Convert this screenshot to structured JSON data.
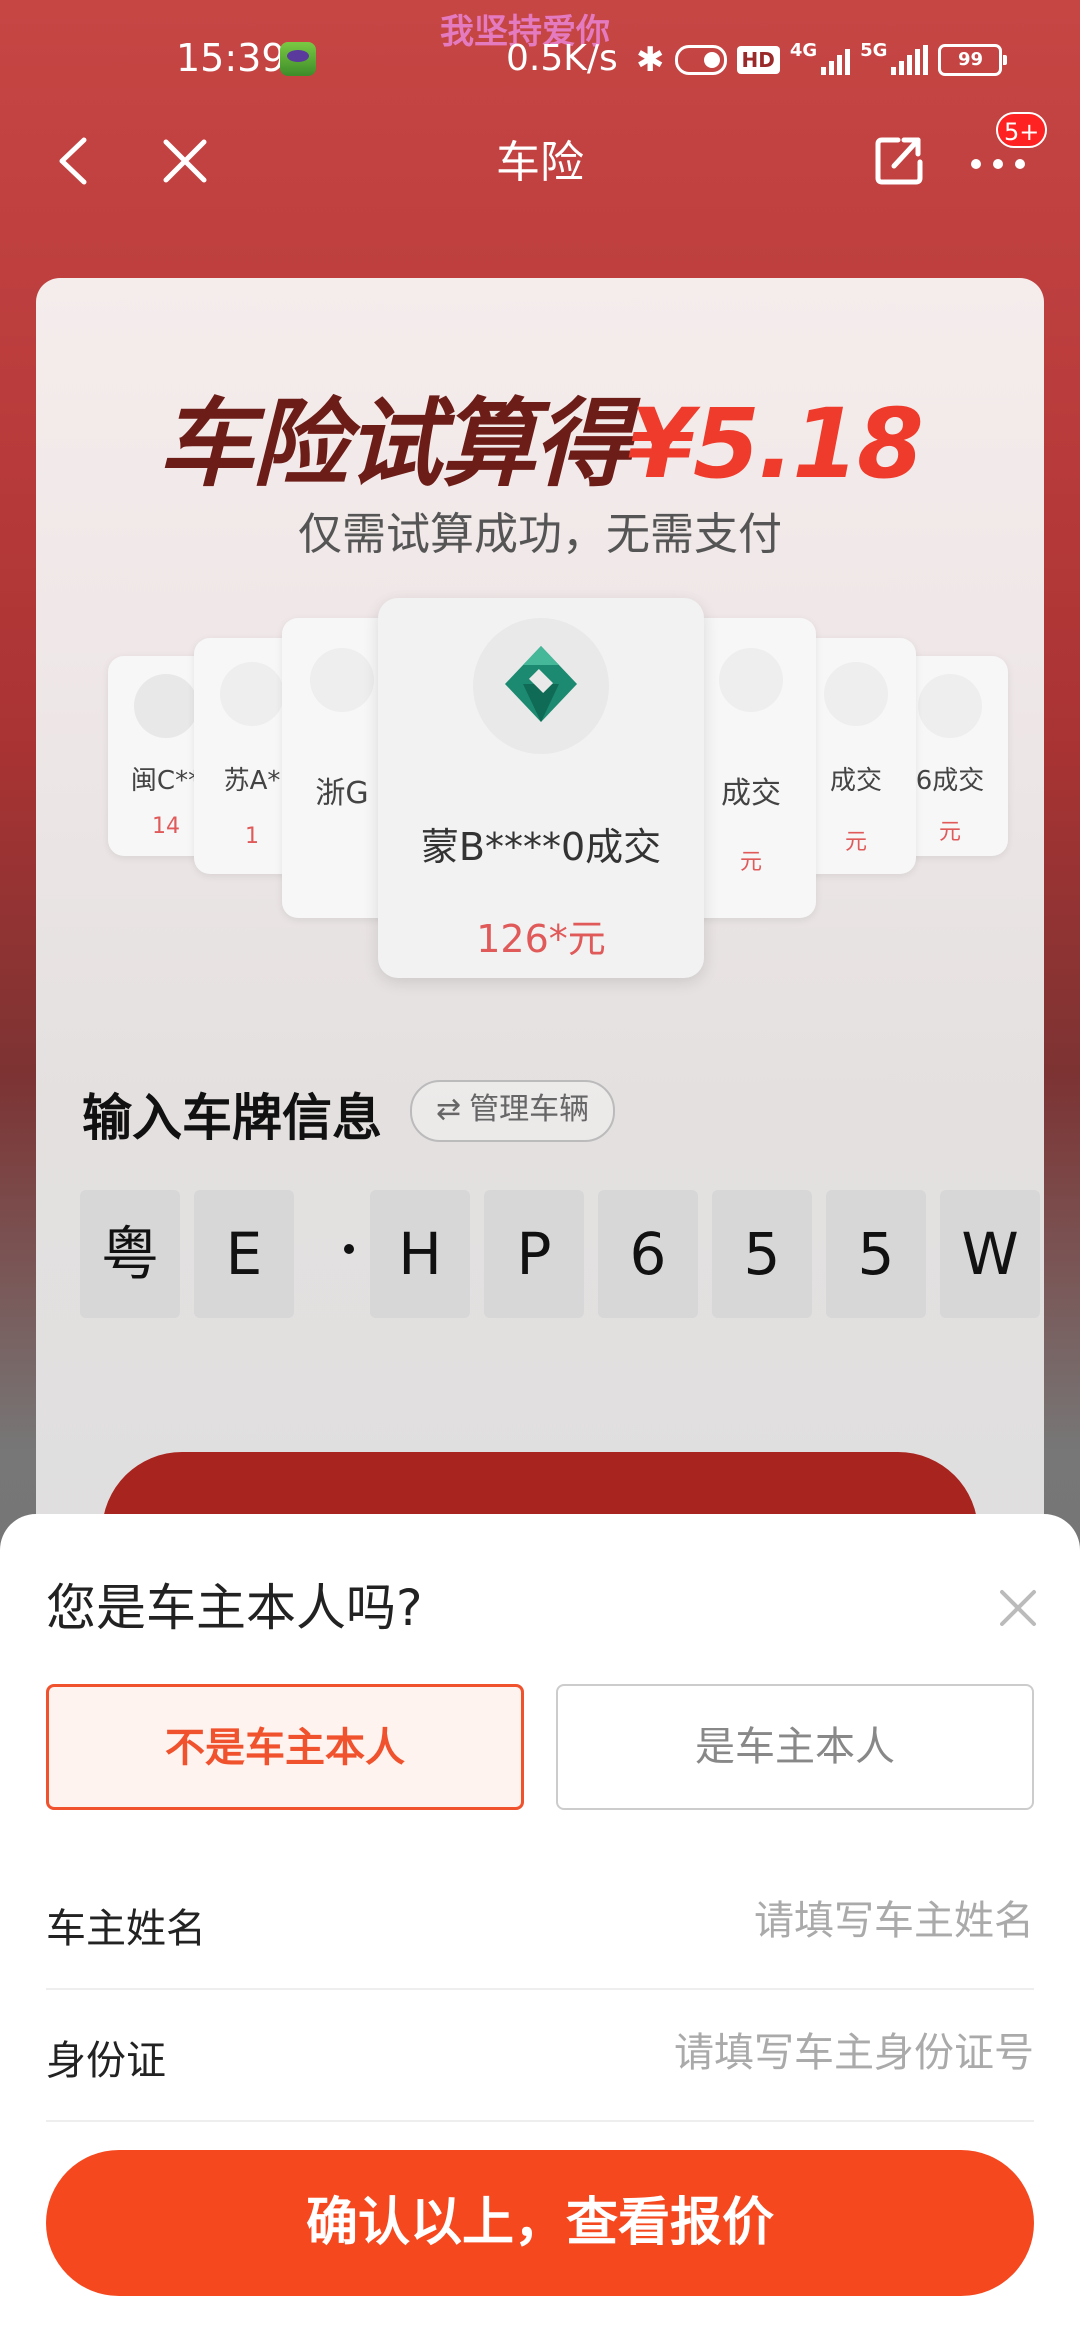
{
  "status_bar": {
    "time": "15:39",
    "overlay_text": "我坚持爱你",
    "net_speed": "0.5K/s",
    "hd_label": "HD",
    "network_4g": "4G",
    "network_5g": "5G",
    "battery": "99"
  },
  "nav": {
    "title": "车险",
    "badge": "5+"
  },
  "promo": {
    "title_part1": "车险试算得",
    "title_part2": "¥5.18",
    "subtitle": "仅需试算成功，无需支付",
    "cards": [
      {
        "plate": "闽C**",
        "price": "14"
      },
      {
        "plate": "苏A*",
        "price": "1"
      },
      {
        "plate": "浙G",
        "price": ""
      },
      {
        "plate": "蒙B****0成交",
        "price": "126*元"
      },
      {
        "plate": "成交",
        "price": "元"
      },
      {
        "plate": "成交",
        "price": "元"
      },
      {
        "plate": "6成交",
        "price": "元"
      }
    ]
  },
  "plate_section": {
    "heading": "输入车牌信息",
    "manage_icon": "⇄",
    "manage_label": "管理车辆",
    "chars": [
      "粤",
      "E",
      "H",
      "P",
      "6",
      "5",
      "5",
      "W"
    ]
  },
  "modal": {
    "title": "您是车主本人吗?",
    "option_not_owner": "不是车主本人",
    "option_owner": "是车主本人",
    "name_label": "车主姓名",
    "name_placeholder": "请填写车主姓名",
    "id_label": "身份证",
    "id_placeholder": "请填写车主身份证号",
    "confirm": "确认以上，查看报价"
  },
  "colors": {
    "accent": "#f5481e",
    "selected_border": "#f0522e",
    "brand_red": "#ef3b2c"
  }
}
